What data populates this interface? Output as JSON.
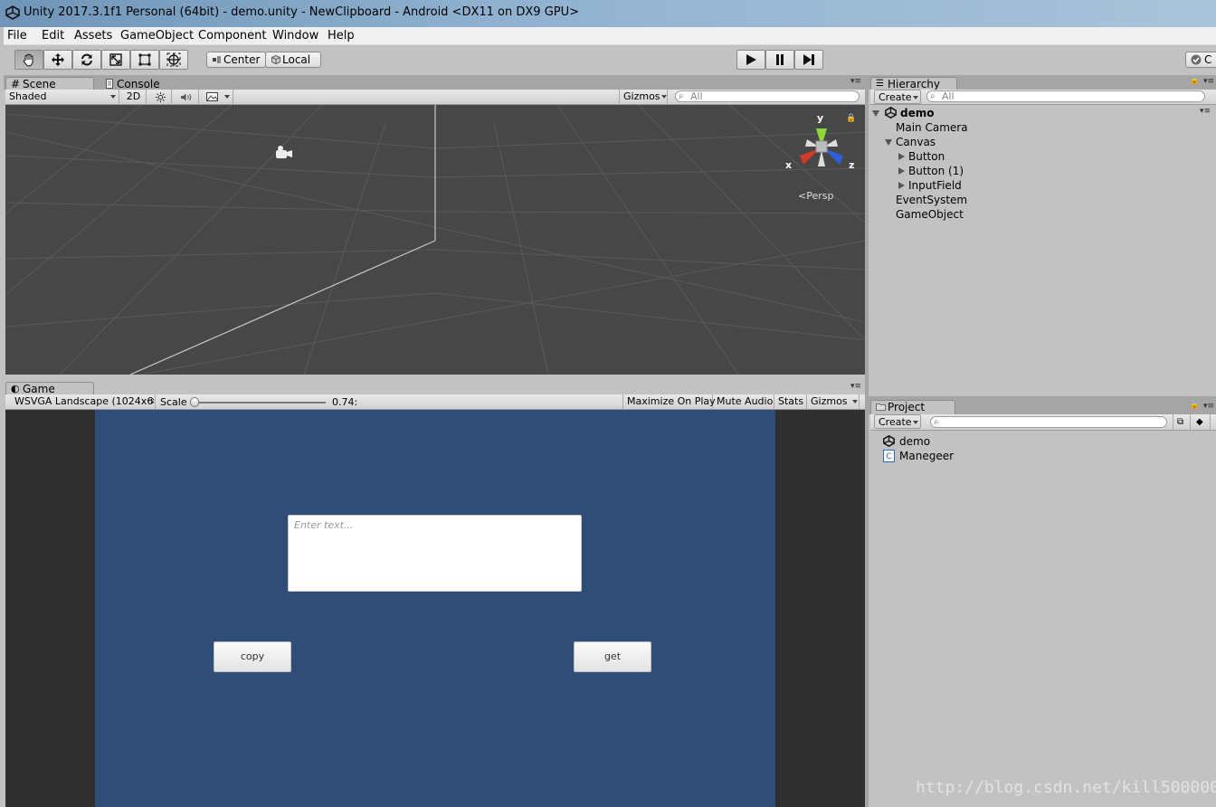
{
  "window": {
    "title": "Unity 2017.3.1f1 Personal (64bit) - demo.unity - NewClipboard - Android <DX11 on DX9 GPU>"
  },
  "menu": [
    "File",
    "Edit",
    "Assets",
    "GameObject",
    "Component",
    "Window",
    "Help"
  ],
  "toolbar": {
    "tools": [
      "hand-tool",
      "move-tool",
      "rotate-tool",
      "scale-tool",
      "rect-tool",
      "transform-tool"
    ],
    "pivot_label": "Center",
    "space_label": "Local",
    "collab_label": "C"
  },
  "scene": {
    "tab_label": "Scene",
    "console_tab_label": "Console",
    "shading": "Shaded",
    "mode_2d": "2D",
    "gizmos_label": "Gizmos",
    "search_placeholder": "All",
    "gizmo": {
      "y": "y",
      "x": "x",
      "z": "z",
      "persp": "Persp"
    }
  },
  "game": {
    "tab_label": "Game",
    "resolution": "WSVGA Landscape (1024x6",
    "scale_label": "Scale",
    "scale_value": "0.74:",
    "scale_slider_level": 0,
    "maximize_label": "Maximize On Play",
    "mute_label": "Mute Audio",
    "stats_label": "Stats",
    "gizmos_label": "Gizmos",
    "input_placeholder": "Enter text...",
    "copy_label": "copy",
    "get_label": "get",
    "canvas_color": "#304d78"
  },
  "hierarchy": {
    "tab_label": "Hierarchy",
    "create_label": "Create",
    "search_placeholder": "All",
    "scene_name": "demo",
    "items": {
      "main_camera": "Main Camera",
      "canvas": "Canvas",
      "button": "Button",
      "button1": "Button (1)",
      "input_field": "InputField",
      "event_system": "EventSystem",
      "game_object": "GameObject"
    }
  },
  "project": {
    "tab_label": "Project",
    "create_label": "Create",
    "items": [
      "demo",
      "Manegeer"
    ]
  },
  "watermark": "http://blog.csdn.net/kill500000"
}
